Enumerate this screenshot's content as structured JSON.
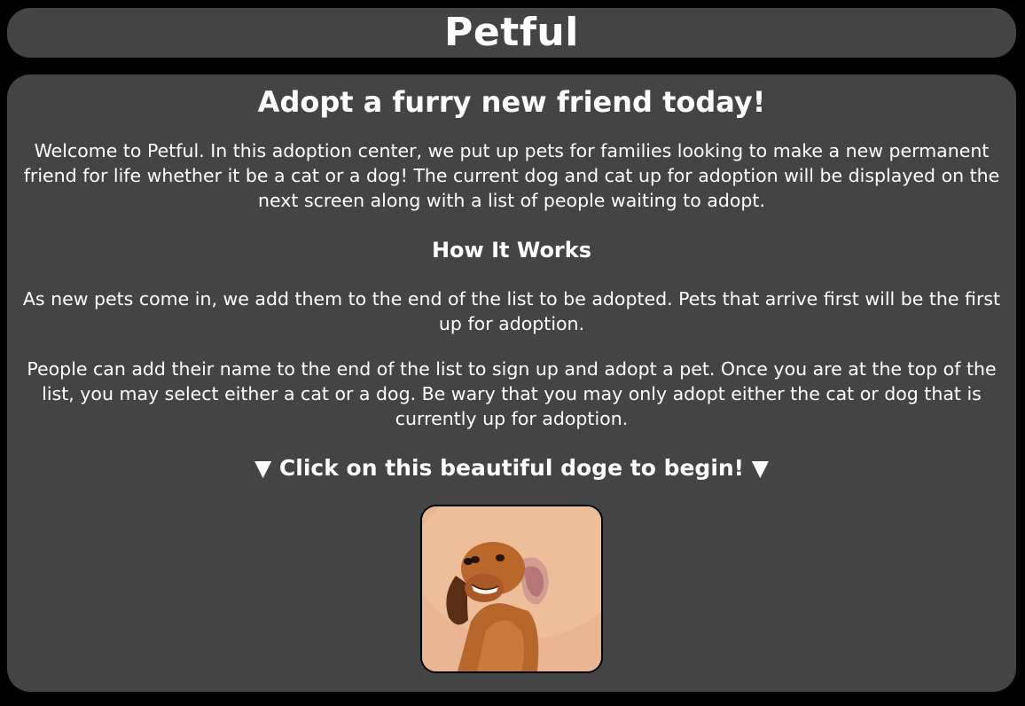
{
  "header": {
    "title": "Petful"
  },
  "main": {
    "headline": "Adopt a furry new friend today!",
    "intro": "Welcome to Petful. In this adoption center, we put up pets for families looking to make a new permanent friend for life whether it be a cat or a dog! The current dog and cat up for adoption will be displayed on the next screen along with a list of people waiting to adopt.",
    "how_heading": "How It Works",
    "paragraphs": [
      "As new pets come in, we add them to the end of the list to be adopted. Pets that arrive first will be the first up for adoption.",
      "People can add their name to the end of the list to sign up and adopt a pet. Once you are at the top of the list, you may select either a cat or a dog. Be wary that you may only adopt either the cat or dog that is currently up for adoption."
    ],
    "cta": "▼ Click on this beautiful doge to begin! ▼",
    "dog_image": {
      "icon": "dog-photo",
      "background_color": "#e9b48f"
    }
  },
  "colors": {
    "page_background": "#000000",
    "panel_background": "#444444",
    "text": "#ffffff"
  }
}
